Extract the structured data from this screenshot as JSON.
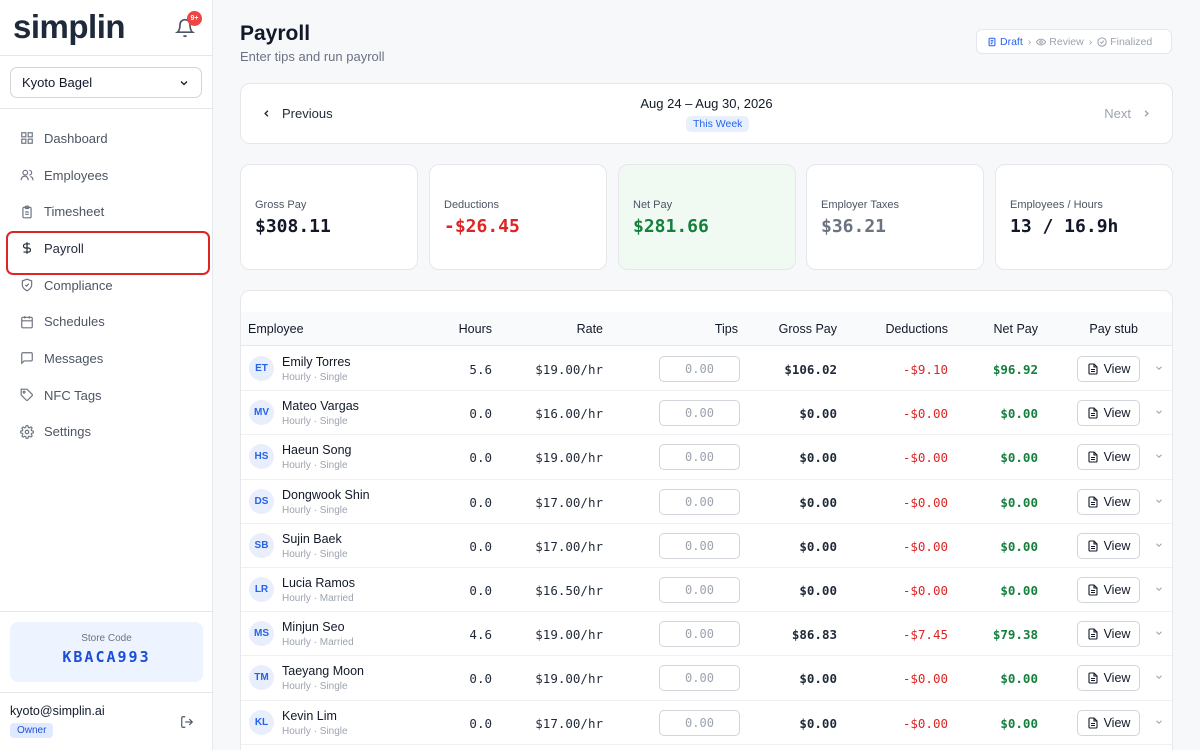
{
  "brand": {
    "logo": "simplin",
    "notification_badge": "9+"
  },
  "store_selector": {
    "value": "Kyoto Bagel"
  },
  "nav": [
    {
      "label": "Dashboard",
      "icon": "grid-icon"
    },
    {
      "label": "Employees",
      "icon": "users-icon"
    },
    {
      "label": "Timesheet",
      "icon": "clipboard-icon"
    },
    {
      "label": "Payroll",
      "icon": "dollar-icon",
      "active": true
    },
    {
      "label": "Compliance",
      "icon": "shield-icon"
    },
    {
      "label": "Schedules",
      "icon": "calendar-icon"
    },
    {
      "label": "Messages",
      "icon": "message-icon"
    },
    {
      "label": "NFC Tags",
      "icon": "tag-icon"
    },
    {
      "label": "Settings",
      "icon": "gear-icon"
    }
  ],
  "store_code": {
    "label": "Store Code",
    "value": "KBACA993"
  },
  "user": {
    "email": "kyoto@simplin.ai",
    "role": "Owner"
  },
  "header": {
    "title": "Payroll",
    "subtitle": "Enter tips and run payroll"
  },
  "steps": [
    {
      "label": "Draft",
      "active": true
    },
    {
      "label": "Review"
    },
    {
      "label": "Finalized"
    }
  ],
  "week": {
    "prev_label": "Previous",
    "next_label": "Next",
    "range": "Aug 24 – Aug 30, 2026",
    "badge": "This Week"
  },
  "stats": [
    {
      "label": "Gross Pay",
      "value": "$308.11",
      "color": "#111827"
    },
    {
      "label": "Deductions",
      "value": "-$26.45",
      "color": "#dc2626"
    },
    {
      "label": "Net Pay",
      "value": "$281.66",
      "color": "#15803d"
    },
    {
      "label": "Employer Taxes",
      "value": "$36.21",
      "color": "#6b7280"
    },
    {
      "label": "Employees / Hours",
      "value": "13 / 16.9h",
      "color": "#111827"
    }
  ],
  "table": {
    "columns": [
      "Employee",
      "Hours",
      "Rate",
      "Tips",
      "Gross Pay",
      "Deductions",
      "Net Pay",
      "Pay stub"
    ],
    "view_label": "View",
    "tips_placeholder": "0.00",
    "rows": [
      {
        "initials": "ET",
        "name": "Emily Torres",
        "meta": "Hourly · Single",
        "hours": "5.6",
        "rate": "$19.00/hr",
        "gross": "$106.02",
        "deductions": "-$9.10",
        "net": "$96.92"
      },
      {
        "initials": "MV",
        "name": "Mateo Vargas",
        "meta": "Hourly · Single",
        "hours": "0.0",
        "rate": "$16.00/hr",
        "gross": "$0.00",
        "deductions": "-$0.00",
        "net": "$0.00"
      },
      {
        "initials": "HS",
        "name": "Haeun Song",
        "meta": "Hourly · Single",
        "hours": "0.0",
        "rate": "$19.00/hr",
        "gross": "$0.00",
        "deductions": "-$0.00",
        "net": "$0.00"
      },
      {
        "initials": "DS",
        "name": "Dongwook Shin",
        "meta": "Hourly · Single",
        "hours": "0.0",
        "rate": "$17.00/hr",
        "gross": "$0.00",
        "deductions": "-$0.00",
        "net": "$0.00"
      },
      {
        "initials": "SB",
        "name": "Sujin Baek",
        "meta": "Hourly · Single",
        "hours": "0.0",
        "rate": "$17.00/hr",
        "gross": "$0.00",
        "deductions": "-$0.00",
        "net": "$0.00"
      },
      {
        "initials": "LR",
        "name": "Lucia Ramos",
        "meta": "Hourly · Married",
        "hours": "0.0",
        "rate": "$16.50/hr",
        "gross": "$0.00",
        "deductions": "-$0.00",
        "net": "$0.00"
      },
      {
        "initials": "MS",
        "name": "Minjun Seo",
        "meta": "Hourly · Married",
        "hours": "4.6",
        "rate": "$19.00/hr",
        "gross": "$86.83",
        "deductions": "-$7.45",
        "net": "$79.38"
      },
      {
        "initials": "TM",
        "name": "Taeyang Moon",
        "meta": "Hourly · Single",
        "hours": "0.0",
        "rate": "$19.00/hr",
        "gross": "$0.00",
        "deductions": "-$0.00",
        "net": "$0.00"
      },
      {
        "initials": "KL",
        "name": "Kevin Lim",
        "meta": "Hourly · Single",
        "hours": "0.0",
        "rate": "$17.00/hr",
        "gross": "$0.00",
        "deductions": "-$0.00",
        "net": "$0.00"
      }
    ]
  }
}
